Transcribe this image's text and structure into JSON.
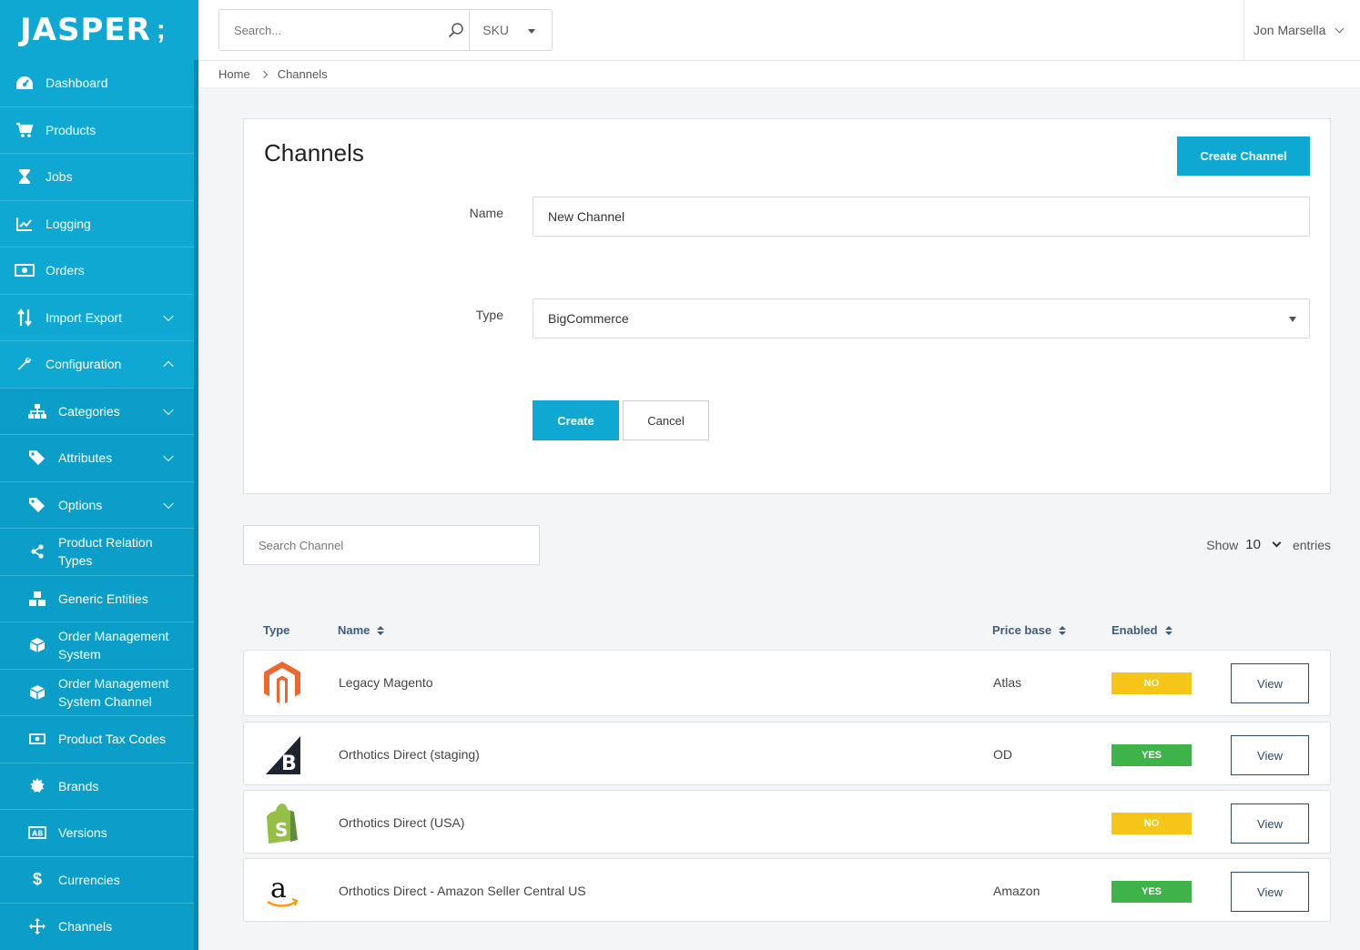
{
  "brand": {
    "logo_text": "JASPER",
    "accent_color": "#0ea8d2"
  },
  "sidebar": {
    "items": [
      {
        "label": "Dashboard",
        "icon": "dashboard-icon",
        "glyph": "◕"
      },
      {
        "label": "Products",
        "icon": "cart-icon",
        "glyph": "🛒"
      },
      {
        "label": "Jobs",
        "icon": "hourglass-icon",
        "glyph": "⧗"
      },
      {
        "label": "Logging",
        "icon": "chart-icon",
        "glyph": "📈"
      },
      {
        "label": "Orders",
        "icon": "money-icon",
        "glyph": "▣"
      },
      {
        "label": "Import Export",
        "icon": "sort-arrows-icon",
        "glyph": "⇅",
        "expandable": true
      },
      {
        "label": "Configuration",
        "icon": "wrench-icon",
        "glyph": "🔧",
        "expanded": true
      }
    ],
    "sub_items": [
      {
        "label": "Categories",
        "icon": "sitemap-icon",
        "glyph": "⊶",
        "expandable": true
      },
      {
        "label": "Attributes",
        "icon": "tags-icon",
        "glyph": "🏷",
        "expandable": true
      },
      {
        "label": "Options",
        "icon": "tag-icon",
        "glyph": "🏷",
        "expandable": true
      },
      {
        "label": "Product Relation Types",
        "icon": "share-icon",
        "glyph": "⋖"
      },
      {
        "label": "Generic Entities",
        "icon": "cubes-icon",
        "glyph": "❖"
      },
      {
        "label": "Order Management System",
        "icon": "cube-icon",
        "glyph": "⬢"
      },
      {
        "label": "Order Management System Channel",
        "icon": "cube-icon",
        "glyph": "⬢"
      },
      {
        "label": "Product Tax Codes",
        "icon": "money-icon",
        "glyph": "▣"
      },
      {
        "label": "Brands",
        "icon": "certificate-icon",
        "glyph": "✹"
      },
      {
        "label": "Versions",
        "icon": "versions-icon",
        "glyph": "▤"
      },
      {
        "label": "Currencies",
        "icon": "dollar-icon",
        "glyph": "$"
      },
      {
        "label": "Channels",
        "icon": "move-icon",
        "glyph": "✥"
      }
    ]
  },
  "header": {
    "search_placeholder": "Search...",
    "search_scope": "SKU",
    "user_name": "Jon Marsella"
  },
  "breadcrumb": {
    "home": "Home",
    "current": "Channels"
  },
  "panel": {
    "title": "Channels",
    "create_channel_label": "Create Channel",
    "name_label": "Name",
    "name_value": "New Channel",
    "type_label": "Type",
    "type_value": "BigCommerce",
    "create_label": "Create",
    "cancel_label": "Cancel"
  },
  "table": {
    "search_placeholder": "Search Channel",
    "show_label": "Show",
    "show_count": "10",
    "entries_label": "entries",
    "headers": {
      "type": "Type",
      "name": "Name",
      "price_base": "Price base",
      "enabled": "Enabled"
    },
    "rows": [
      {
        "type": "magento-logo-icon",
        "name": "Legacy Magento",
        "price_base": "Atlas",
        "enabled": "NO",
        "view": "View"
      },
      {
        "type": "bigcommerce-logo-icon",
        "name": "Orthotics Direct (staging)",
        "price_base": "OD",
        "enabled": "YES",
        "view": "View"
      },
      {
        "type": "shopify-logo-icon",
        "name": "Orthotics Direct (USA)",
        "price_base": "",
        "enabled": "NO",
        "view": "View"
      },
      {
        "type": "amazon-logo-icon",
        "name": "Orthotics Direct - Amazon Seller Central US",
        "price_base": "Amazon",
        "enabled": "YES",
        "view": "View"
      }
    ]
  }
}
